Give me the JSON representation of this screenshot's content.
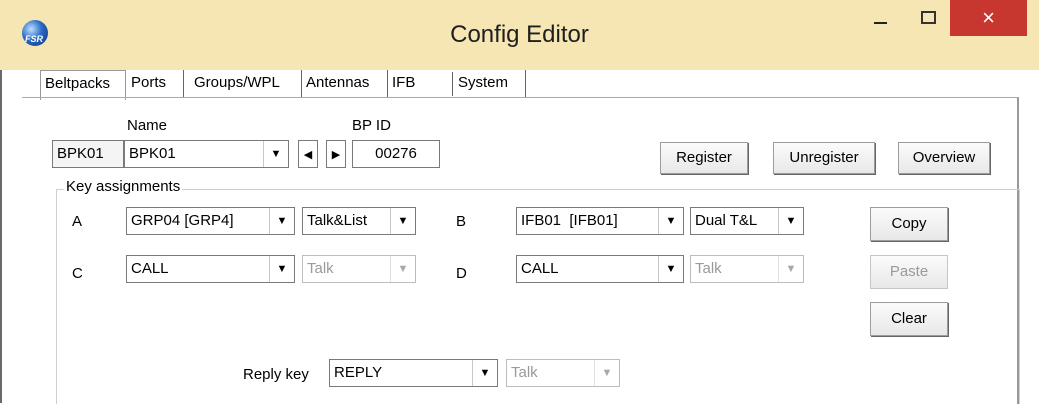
{
  "window": {
    "title": "Config Editor",
    "close_glyph": "×"
  },
  "tabs": [
    {
      "label": "Beltpacks"
    },
    {
      "label": "Ports"
    },
    {
      "label": "Groups/WPL"
    },
    {
      "label": "Antennas"
    },
    {
      "label": "IFB"
    },
    {
      "label": "System"
    }
  ],
  "beltpack": {
    "current_label": "BPK01",
    "name_label": "Name",
    "name_value": "BPK01",
    "bpid_label": "BP ID",
    "bpid_value": "00276"
  },
  "buttons": {
    "register": "Register",
    "unregister": "Unregister",
    "overview": "Overview",
    "copy": "Copy",
    "paste": "Paste",
    "clear": "Clear"
  },
  "key_assignments": {
    "title": "Key assignments",
    "keys": [
      {
        "key": "A",
        "assignment": "GRP04 [GRP4]",
        "mode": "Talk&List",
        "mode_enabled": true
      },
      {
        "key": "B",
        "assignment": "IFB01  [IFB01]",
        "mode": "Dual T&L",
        "mode_enabled": true
      },
      {
        "key": "C",
        "assignment": "CALL",
        "mode": "Talk",
        "mode_enabled": false
      },
      {
        "key": "D",
        "assignment": "CALL",
        "mode": "Talk",
        "mode_enabled": false
      }
    ],
    "reply_label": "Reply key",
    "reply_value": "REPLY",
    "reply_mode": "Talk"
  },
  "icons": {
    "dropdown": "▼",
    "prev": "◀",
    "next": "▶"
  },
  "colors": {
    "titlebar": "#f5e6b4",
    "close_button": "#c7372f"
  }
}
